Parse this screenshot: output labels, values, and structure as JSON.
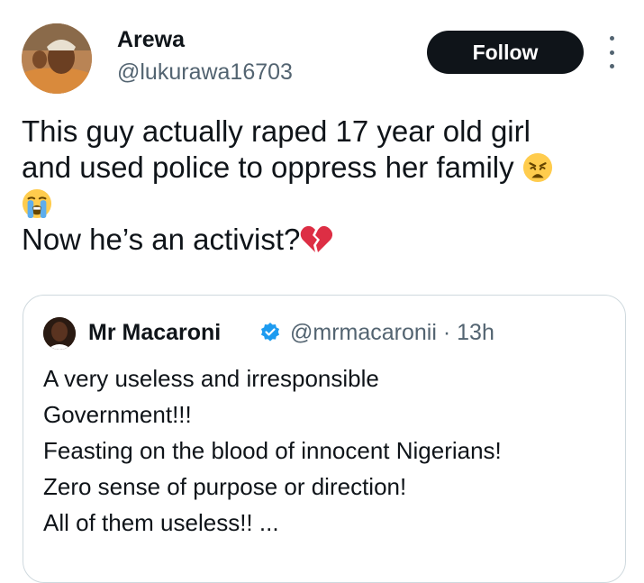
{
  "author": {
    "display_name": "Arewa",
    "handle": "@lukurawa16703"
  },
  "follow_button": {
    "label": "Follow"
  },
  "icons": {
    "more": "more-vertical-icon",
    "weary": "weary-face-emoji",
    "crying": "loudly-crying-face-emoji",
    "broken_heart": "broken-heart-emoji",
    "verified": "verified-badge-icon"
  },
  "tweet": {
    "line1": "This guy actually raped 17 year old girl",
    "line2": "and used police to oppress her family",
    "line4": "Now he’s an activist?"
  },
  "quoted": {
    "display_name": "Mr Macaroni",
    "handle": "@mrmacaronii",
    "separator": "·",
    "time": "13h",
    "lines": [
      "A very useless and irresponsible",
      "Government!!!",
      "Feasting on the blood of innocent Nigerians!",
      "Zero sense of purpose or direction!",
      "All of them useless!! ..."
    ]
  },
  "colors": {
    "text": "#0f1419",
    "secondary": "#536471",
    "verified": "#1d9bf0",
    "button_bg": "#0f1419",
    "border": "#cfd9de"
  }
}
